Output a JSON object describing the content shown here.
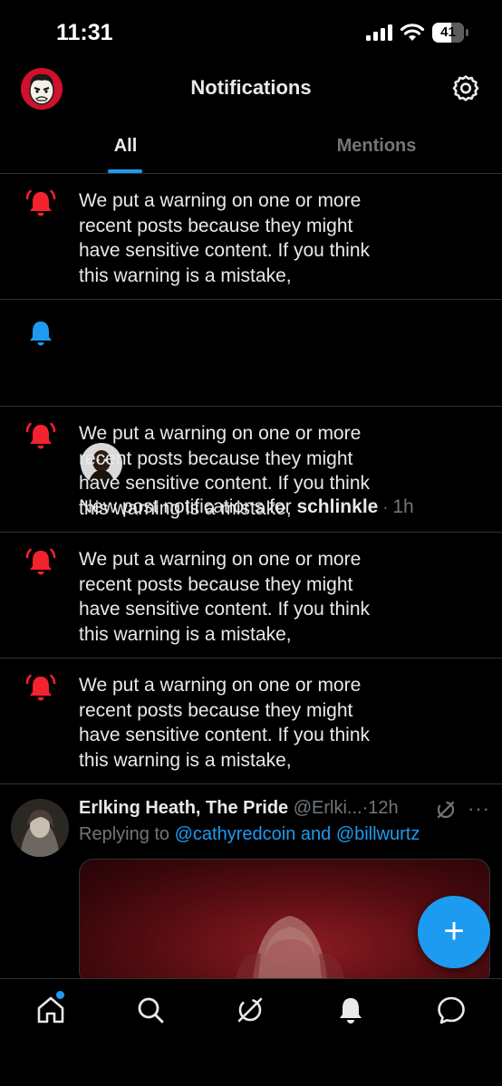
{
  "status_bar": {
    "time": "11:31",
    "battery": "41",
    "icons": [
      "signal-icon",
      "wifi-icon",
      "battery-icon"
    ]
  },
  "header": {
    "title": "Notifications",
    "settings_icon": "gear-icon"
  },
  "tabs": [
    {
      "label": "All",
      "active": true
    },
    {
      "label": "Mentions",
      "active": false
    }
  ],
  "notifications": [
    {
      "type": "warning",
      "icon": "alert-bell-icon",
      "text": "We put a warning on one or more recent posts because they might have sensitive content. If you think this warning is a mistake,"
    },
    {
      "type": "subscription",
      "icon": "bell-icon",
      "prefix": "New post notifications for ",
      "user": "schlinkle",
      "time": "1h"
    },
    {
      "type": "warning",
      "icon": "alert-bell-icon",
      "text": "We put a warning on one or more recent posts because they might have sensitive content. If you think this warning is a mistake,"
    },
    {
      "type": "warning",
      "icon": "alert-bell-icon",
      "text": "We put a warning on one or more recent posts because they might have sensitive content. If you think this warning is a mistake,"
    },
    {
      "type": "warning",
      "icon": "alert-bell-icon",
      "text": "We put a warning on one or more recent posts because they might have sensitive content. If you think this warning is a mistake,"
    }
  ],
  "reply_post": {
    "name": "Erlking Heath, The Pride",
    "handle": "@Erlki...",
    "time": "12h",
    "replying_prefix": "Replying to ",
    "mention1": "@cathyredcoin",
    "and": " and ",
    "mention2": "@billwurtz",
    "more": "···"
  },
  "fab": {
    "label": "+"
  },
  "bottom_nav": [
    "home-icon",
    "search-icon",
    "grok-icon",
    "notifications-icon",
    "messages-icon"
  ],
  "colors": {
    "accent": "#1d9bf0",
    "warning": "#f4212e",
    "background": "#000000",
    "muted": "#71767b"
  }
}
